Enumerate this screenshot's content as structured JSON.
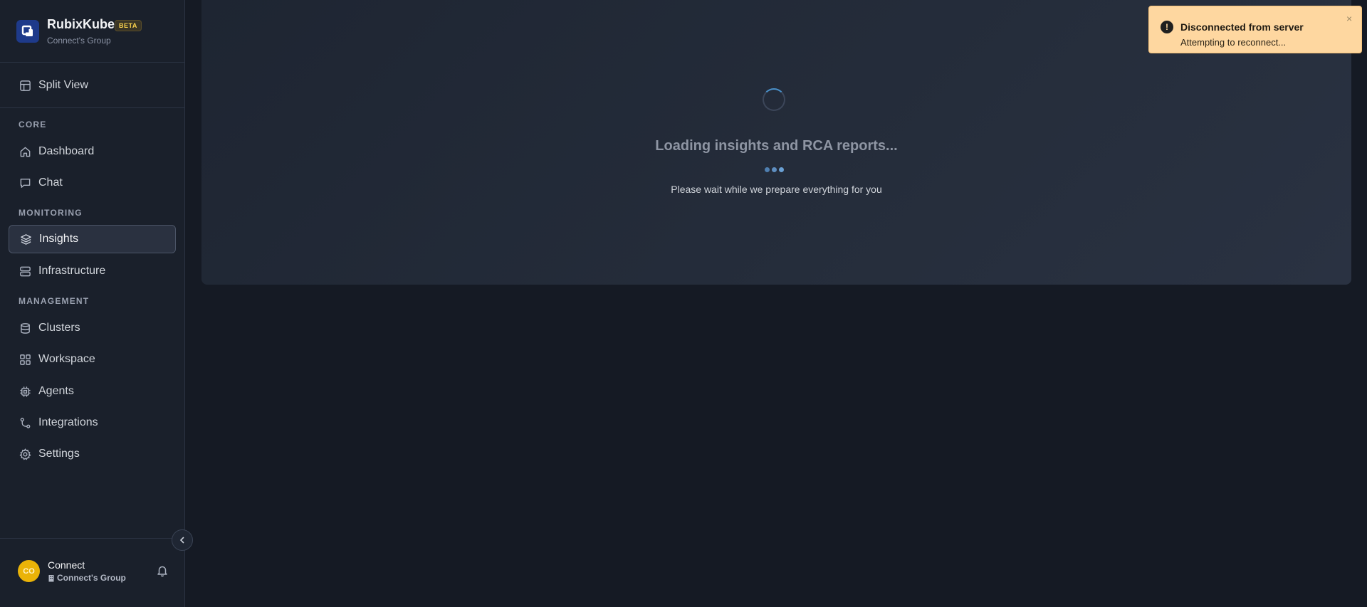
{
  "brand": {
    "name": "RubixKube",
    "badge": "BETA",
    "group": "Connect's Group"
  },
  "nav": {
    "split_view": "Split View",
    "sections": {
      "core": "CORE",
      "monitoring": "MONITORING",
      "management": "MANAGEMENT"
    },
    "items": {
      "dashboard": "Dashboard",
      "chat": "Chat",
      "insights": "Insights",
      "infrastructure": "Infrastructure",
      "clusters": "Clusters",
      "workspace": "Workspace",
      "agents": "Agents",
      "integrations": "Integrations",
      "settings": "Settings"
    },
    "active": "insights"
  },
  "user": {
    "initials": "CO",
    "name": "Connect",
    "group": "Connect's Group"
  },
  "main": {
    "loading_title": "Loading insights and RCA reports...",
    "loading_subtitle": "Please wait while we prepare everything for you"
  },
  "toast": {
    "title": "Disconnected from server",
    "message": "Attempting to reconnect...",
    "icon": "exclamation-icon",
    "close": "×"
  },
  "colors": {
    "sidebar_bg": "#1a202b",
    "page_bg": "#151a24",
    "toast_bg": "#fed7a0",
    "accent": "#4a90c9",
    "avatar": "#eab308"
  }
}
